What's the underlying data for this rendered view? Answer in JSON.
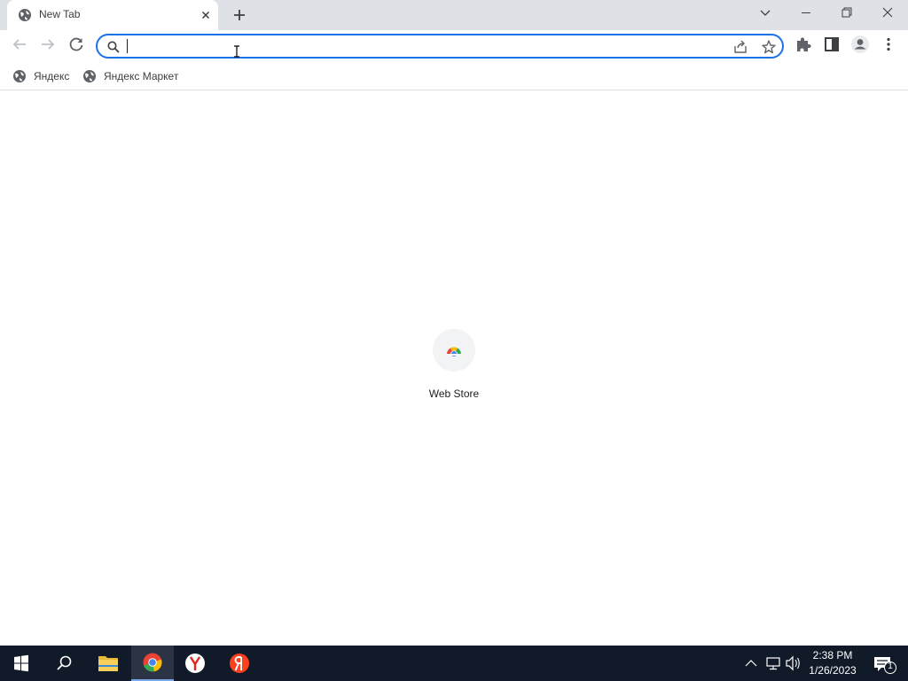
{
  "browser": {
    "tab": {
      "title": "New Tab",
      "favicon": "globe-icon"
    },
    "window_controls": [
      "tab-search-icon",
      "minimize-icon",
      "restore-icon",
      "close-icon"
    ]
  },
  "toolbar": {
    "address": {
      "value": "",
      "placeholder": ""
    },
    "icons": [
      "back-icon",
      "forward-icon",
      "reload-icon",
      "search-icon",
      "share-icon",
      "star-icon",
      "extensions-icon",
      "side-panel-icon",
      "profile-icon",
      "menu-icon"
    ]
  },
  "bookmarks": [
    {
      "label": "Яндекс",
      "icon": "globe-icon"
    },
    {
      "label": "Яндекс Маркет",
      "icon": "globe-icon"
    }
  ],
  "shortcuts": [
    {
      "label": "Web Store",
      "icon": "web-store-icon"
    }
  ],
  "taskbar": {
    "apps": [
      "windows-start-icon",
      "search-icon",
      "file-explorer-icon",
      "chrome-icon",
      "yandex-browser-icon",
      "yandex-icon"
    ],
    "time": "2:38 PM",
    "date": "1/26/2023",
    "notifications_count": "1"
  },
  "colors": {
    "accent": "#1a73e8",
    "tabstrip": "#dee1e6",
    "taskbar": "#101a29"
  }
}
